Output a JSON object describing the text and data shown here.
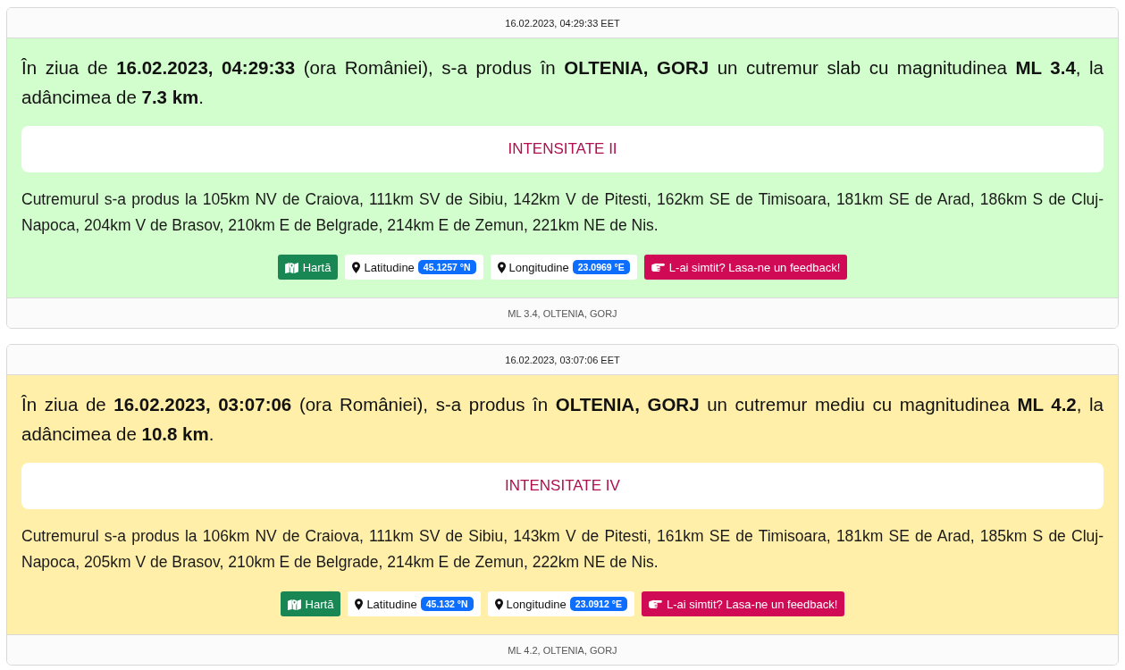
{
  "events": [
    {
      "header": "16.02.2023, 04:29:33 EET",
      "color": "#d2fdcc",
      "description": "În ziua de **16.02.2023, 04:29:33** (ora României), s-a produs în **OLTENIA, GORJ** un cutremur slab cu magnitudinea **ML 3.4**, la adâncimea de **7.3 km**.",
      "intensity": "INTENSITATE II",
      "distances": "Cutremurul s-a produs la 105km NV de Craiova, 111km SV de Sibiu, 142km V de Pitesti, 162km SE de Timisoara, 181km SE de Arad, 186km S de Cluj-Napoca, 204km V de Brasov, 210km E de Belgrade, 214km E de Zemun, 221km NE de Nis.",
      "map_button": "Hartă",
      "latitude": {
        "label": "Latitudine",
        "value": "45.1257 °N"
      },
      "longitude": {
        "label": "Longitudine",
        "value": "23.0969 °E"
      },
      "feedback_button": "L-ai simtit? Lasa-ne un feedback!",
      "footer": "ML 3.4, OLTENIA, GORJ"
    },
    {
      "header": "16.02.2023, 03:07:06 EET",
      "color": "#ffefa8",
      "description": "În ziua de **16.02.2023, 03:07:06** (ora României), s-a produs în **OLTENIA, GORJ** un cutremur mediu cu magnitudinea **ML 4.2**, la adâncimea de **10.8 km**.",
      "intensity": "INTENSITATE IV",
      "distances": "Cutremurul s-a produs la 106km NV de Craiova, 111km SV de Sibiu, 143km V de Pitesti, 161km SE de Timisoara, 181km SE de Arad, 185km S de Cluj-Napoca, 205km V de Brasov, 210km E de Belgrade, 214km E de Zemun, 222km NE de Nis.",
      "map_button": "Hartă",
      "latitude": {
        "label": "Latitudine",
        "value": "45.132 °N"
      },
      "longitude": {
        "label": "Longitudine",
        "value": "23.0912 °E"
      },
      "feedback_button": "L-ai simtit? Lasa-ne un feedback!",
      "footer": "ML 4.2, OLTENIA, GORJ"
    }
  ]
}
